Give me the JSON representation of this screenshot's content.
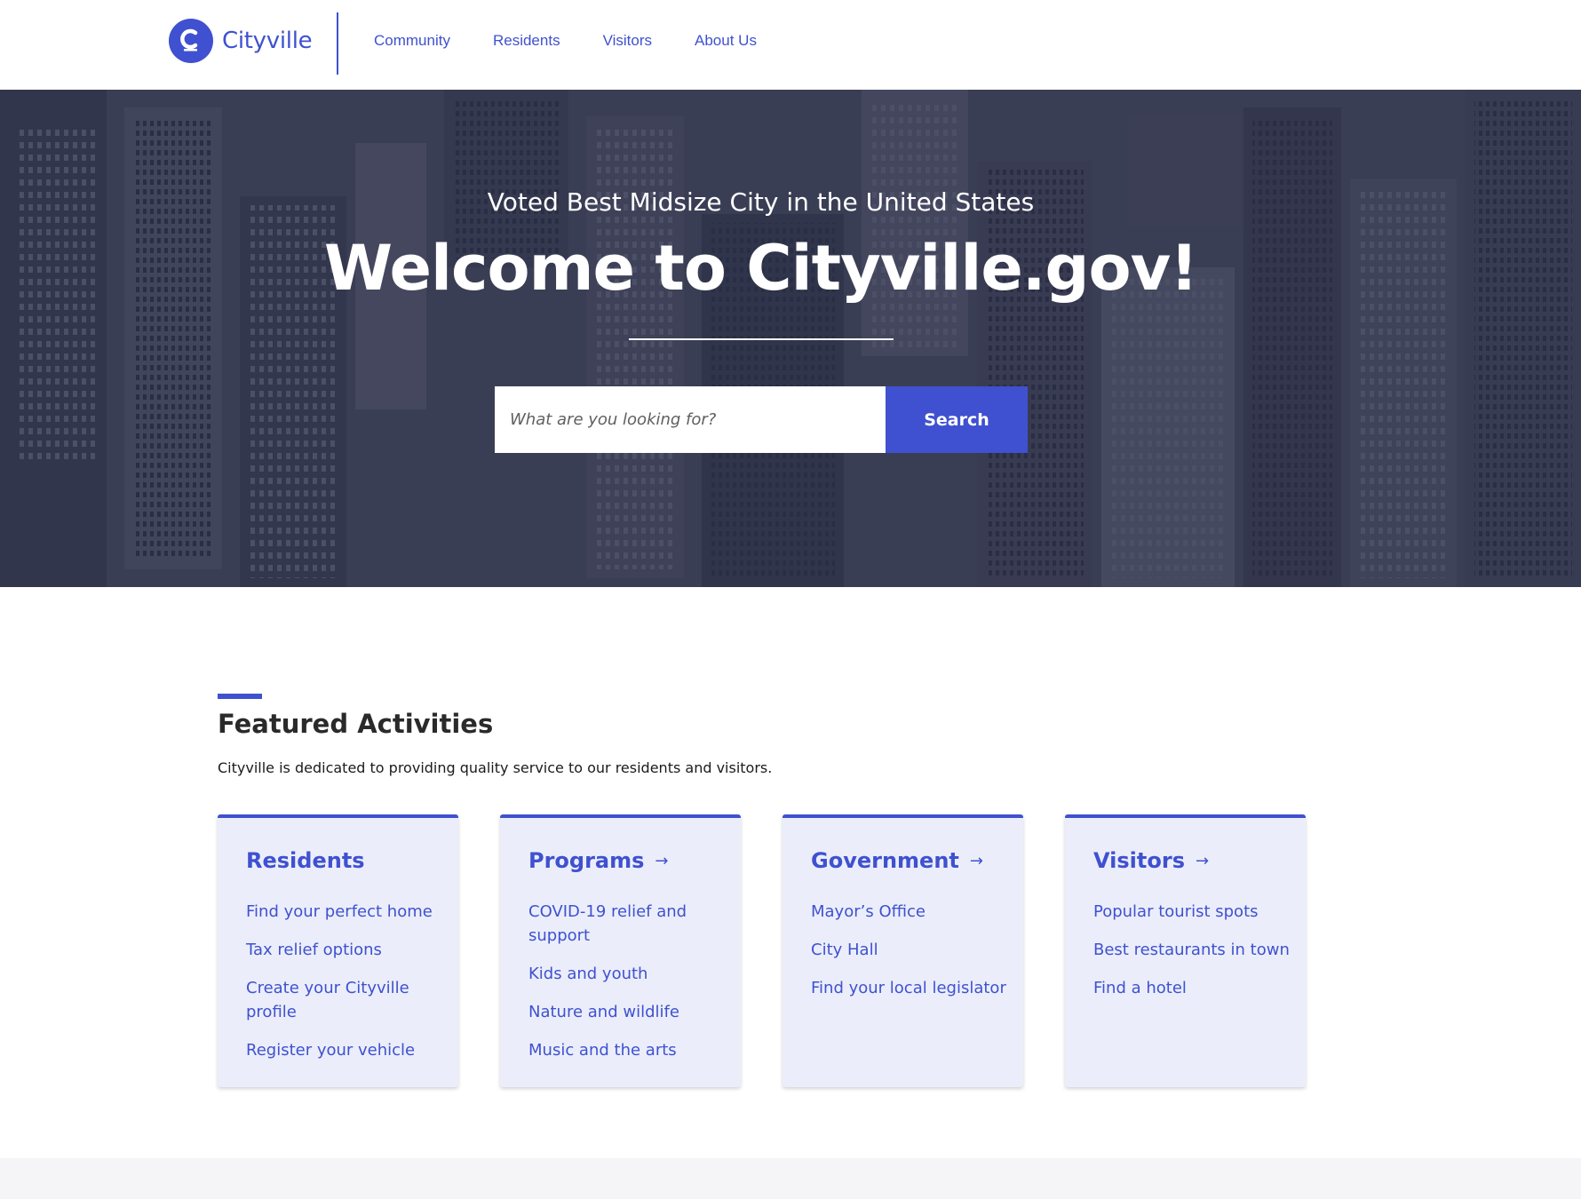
{
  "header": {
    "logo_text": "Cityville",
    "nav": [
      "Community",
      "Residents",
      "Visitors",
      "About Us"
    ]
  },
  "hero": {
    "subtitle": "Voted Best Midsize City in the United States",
    "title": "Welcome to Cityville.gov!",
    "search_placeholder": "What are you looking for?",
    "search_button": "Search"
  },
  "featured": {
    "title": "Featured Activities",
    "description": "Cityville is dedicated to providing quality service to our residents and visitors.",
    "cards": [
      {
        "title": "Residents",
        "has_arrow": false,
        "items": [
          "Find your perfect home",
          "Tax relief options",
          "Create your Cityville profile",
          "Register your vehicle"
        ]
      },
      {
        "title": "Programs",
        "has_arrow": true,
        "items": [
          "COVID-19 relief and support",
          "Kids and youth",
          "Nature and wildlife",
          "Music and the arts"
        ]
      },
      {
        "title": "Government",
        "has_arrow": true,
        "items": [
          "Mayor’s Office",
          "City Hall",
          "Find your local legislator"
        ]
      },
      {
        "title": "Visitors",
        "has_arrow": true,
        "items": [
          "Popular tourist spots",
          "Best restaurants in town",
          "Find a hotel"
        ]
      }
    ]
  },
  "colors": {
    "accent": "#3f51d0",
    "card_bg": "#ebeefa"
  }
}
